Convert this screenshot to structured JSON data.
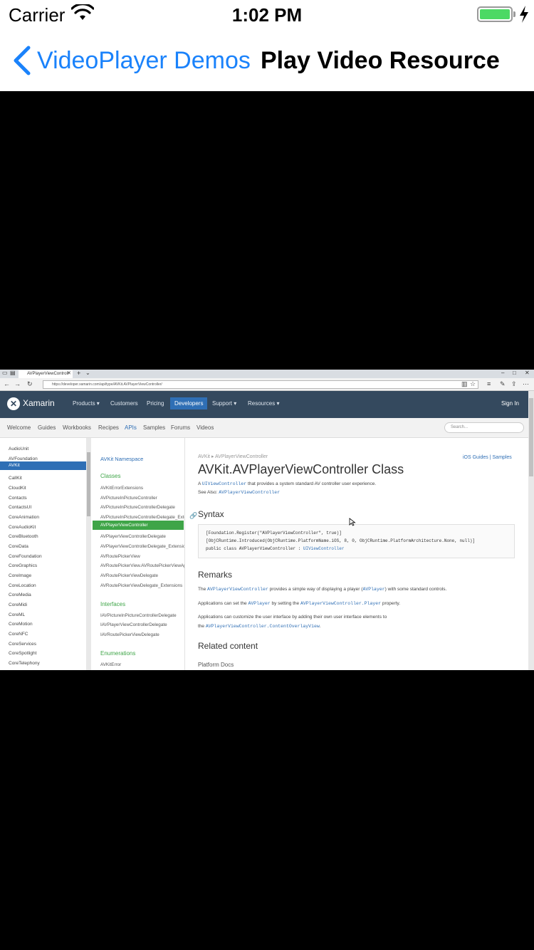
{
  "status_bar": {
    "carrier": "Carrier",
    "time": "1:02 PM",
    "battery_level": 1.0,
    "battery_color": "#4cd964"
  },
  "nav": {
    "back_label": "VideoPlayer Demos",
    "title": "Play Video Resource",
    "accent_color": "#1a82fb"
  },
  "video_frame": {
    "browser": {
      "tab_title": "AVPlayerViewControll",
      "url": "https://developer.xamarin.com/api/type/AVKit.AVPlayerViewController/"
    },
    "site": {
      "brand": "Xamarin",
      "top_nav": [
        "Products ▾",
        "Customers",
        "Pricing",
        "Developers",
        "Support ▾",
        "Resources ▾"
      ],
      "active_top_nav": "Developers",
      "sign_in": "Sign In",
      "sub_nav": [
        "Welcome",
        "Guides",
        "Workbooks",
        "Recipes",
        "APIs",
        "Samples",
        "Forums",
        "Videos"
      ],
      "active_sub_nav": "APIs",
      "search_placeholder": "Search..."
    },
    "left_nav": {
      "items": [
        "AudioUnit",
        "AVFoundation",
        "AVKit",
        "CallKit",
        "CloudKit",
        "Contacts",
        "ContactsUI",
        "CoreAnimation",
        "CoreAudioKit",
        "CoreBluetooth",
        "CoreData",
        "CoreFoundation",
        "CoreGraphics",
        "CoreImage",
        "CoreLocation",
        "CoreMedia",
        "CoreMidi",
        "CoreML",
        "CoreMotion",
        "CoreNFC",
        "CoreServices",
        "CoreSpotlight",
        "CoreTelephony"
      ],
      "active": "AVKit"
    },
    "mid_nav": {
      "namespace": "AVKit Namespace",
      "classes_heading": "Classes",
      "classes": [
        "AVKitErrorExtensions",
        "AVPictureInPictureController",
        "AVPictureInPictureControllerDelegate",
        "AVPictureInPictureControllerDelegate_Extensions",
        "AVPlayerViewController",
        "AVPlayerViewControllerDelegate",
        "AVPlayerViewControllerDelegate_Extensions",
        "AVRoutePickerView",
        "AVRoutePickerView.AVRoutePickerViewAppearance",
        "AVRoutePickerViewDelegate",
        "AVRoutePickerViewDelegate_Extensions"
      ],
      "active_class": "AVPlayerViewController",
      "interfaces_heading": "Interfaces",
      "interfaces": [
        "IAVPictureInPictureControllerDelegate",
        "IAVPlayerViewControllerDelegate",
        "IAVRoutePickerViewDelegate"
      ],
      "enumerations_heading": "Enumerations",
      "enumerations": [
        "AVKitError"
      ]
    },
    "content": {
      "crumb_ns": "AVKit",
      "crumb_sep": "▸",
      "crumb_class": "AVPlayerViewController",
      "right_links": "iOS Guides | Samples",
      "title": "AVKit.AVPlayerViewController Class",
      "intro_pre": "A ",
      "intro_link": "UIViewController",
      "intro_post": " that provides a system standard AV controller user experience.",
      "see_also_label": "See Also: ",
      "see_also_link": "AVPlayerViewController",
      "syntax_heading": "Syntax",
      "code_lines": [
        "[Foundation.Register(\"AVPlayerViewController\", true)]",
        "[ObjCRuntime.Introduced(ObjCRuntime.PlatformName.iOS, 8, 0, ObjCRuntime.PlatformArchitecture.None, null)]"
      ],
      "code_decl": "public class AVPlayerViewController : ",
      "code_decl_link": "UIViewController",
      "remarks_heading": "Remarks",
      "remarks_1_pre": "The ",
      "remarks_1_link1": "AVPlayerViewController",
      "remarks_1_mid": " provides a simple way of displaying a player (",
      "remarks_1_link2": "AVPlayer",
      "remarks_1_post": ") with some standard controls.",
      "remarks_2_pre": "Applications can set the ",
      "remarks_2_link1": "AVPlayer",
      "remarks_2_mid": " by setting the ",
      "remarks_2_link2": "AVPlayerViewController.Player",
      "remarks_2_post": " property.",
      "remarks_3_line1": "Applications can customize the user interface by adding their own user interface elements to",
      "remarks_3_pre": "the ",
      "remarks_3_link": "AVPlayerViewController.ContentOverlayView",
      "remarks_3_post": ".",
      "related_heading": "Related content",
      "platform_docs": "Platform Docs"
    }
  }
}
